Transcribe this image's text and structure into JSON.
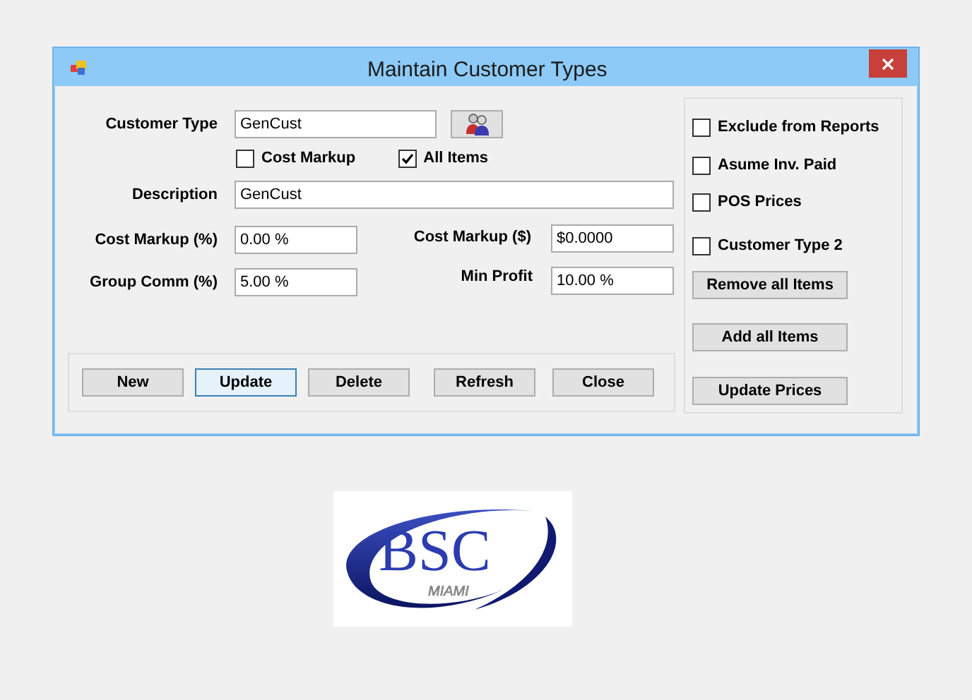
{
  "window": {
    "title": "Maintain Customer Types"
  },
  "customer_type": {
    "label": "Customer Type",
    "value": "GenCust"
  },
  "options": [
    {
      "label": "Cost Markup",
      "checked": false
    },
    {
      "label": "All Items",
      "checked": true
    }
  ],
  "description": {
    "label": "Description",
    "value": "GenCust"
  },
  "cost_markup_percent": {
    "label": "Cost Markup (%)",
    "value": "0.00 %"
  },
  "cost_markup_amount": {
    "label": "Cost Markup ($)",
    "value": "$0.0000"
  },
  "group_comm": {
    "label": "Group Comm (%)",
    "value": "5.00 %"
  },
  "min_profit": {
    "label": "Min Profit",
    "value": "10.00 %"
  },
  "buttons": [
    {
      "label": "New",
      "selected": false
    },
    {
      "label": "Update",
      "selected": true
    },
    {
      "label": "Delete",
      "selected": false
    },
    {
      "label": "Refresh",
      "selected": false
    },
    {
      "label": "Close",
      "selected": false
    }
  ],
  "side_options": [
    {
      "label": "Exclude from Reports",
      "checked": false
    },
    {
      "label": "Asume Inv. Paid",
      "checked": false
    },
    {
      "label": "POS Prices",
      "checked": false
    },
    {
      "label": "Customer Type 2",
      "checked": false
    }
  ],
  "side_buttons": [
    "Remove all Items",
    "Add all Items",
    "Update Prices"
  ],
  "logo": {
    "name": "BSC",
    "tagline": "MIAMI"
  }
}
